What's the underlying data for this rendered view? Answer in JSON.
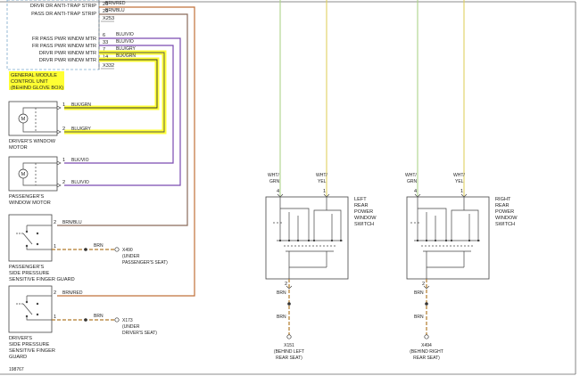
{
  "module": {
    "rows": [
      {
        "label": "DRVR DR ANTI-TRAP STRIP",
        "pin": "26"
      },
      {
        "label": "PASS DR ANTI-TRAP STRIP",
        "pin": "29"
      },
      {
        "label": "",
        "pin": ""
      },
      {
        "label": "FR PASS PWR WNDW MTR",
        "pin": "6"
      },
      {
        "label": "FR PASS PWR WNDW MTR",
        "pin": "33"
      },
      {
        "label": "DRVR PWR WNDW MTR",
        "pin": "7"
      },
      {
        "label": "DRVR PWR WNDW MTR",
        "pin": "14"
      }
    ],
    "connector1": "X253",
    "connector2": "X332",
    "name_lines": [
      "GENERAL MODULE",
      "CONTROL UNIT",
      "(BEHIND GLOVE BOX)"
    ]
  },
  "wires": {
    "w26": "BRN/RED",
    "w29": "BRN/BLU",
    "w6": "BLU/VIO",
    "w33": "BLU/VIO",
    "w7": "BLU/GRY",
    "w14": "BLK/GRN"
  },
  "driver_motor": {
    "name_lines": [
      "DRIVER'S WINDOW",
      "MOTOR"
    ],
    "pin1": "1",
    "wire1": "BLK/GRN",
    "pin2": "2",
    "wire2": "BLU/GRY",
    "symbol": "M"
  },
  "pass_motor": {
    "name_lines": [
      "PASSENGER'S",
      "WINDOW MOTOR"
    ],
    "pin1": "1",
    "wire1": "BLK/VIO",
    "pin2": "2",
    "wire2": "BLU/VIO",
    "symbol": "M"
  },
  "pass_guard": {
    "name_lines": [
      "PASSENGER'S",
      "SIDE PRESSURE",
      "SENSITIVE FINGER GUARD"
    ],
    "pin2": "2",
    "wire2": "BRN/BLU",
    "pin1": "1",
    "wire1": "BRN",
    "ground": "X490",
    "ground_loc": [
      "(UNDER",
      "PASSENGER'S SEAT)"
    ]
  },
  "drv_guard": {
    "name_lines": [
      "DRIVER'S",
      "SIDE PRESSURE",
      "SENSITIVE FINGER",
      "GUARD"
    ],
    "pin2": "2",
    "wire2": "BRN/RED",
    "pin1": "1",
    "wire1": "BRN",
    "ground": "X173",
    "ground_loc": [
      "(UNDER",
      "DRIVER'S SEAT)"
    ]
  },
  "left_switch": {
    "name_lines": [
      "LEFT",
      "REAR",
      "POWER",
      "WINDOW",
      "SWITCH"
    ],
    "in1_wire": [
      "WHT/",
      "GRN"
    ],
    "in1_pin": "4",
    "in2_wire": [
      "WHT/",
      "YEL"
    ],
    "in2_pin": "1",
    "out_pin": "2",
    "out_wire1": "BRN",
    "out_wire2": "BRN",
    "ground": "X151",
    "ground_loc": [
      "(BEHIND LEFT",
      "REAR SEAT)"
    ]
  },
  "right_switch": {
    "name_lines": [
      "RIGHT",
      "REAR",
      "POWER",
      "WINDOW",
      "SWITCH"
    ],
    "in1_wire": [
      "WHT/",
      "GRN"
    ],
    "in1_pin": "4",
    "in2_wire": [
      "WHT/",
      "YEL"
    ],
    "in2_pin": "1",
    "out_pin": "2",
    "out_wire1": "BRN",
    "out_wire2": "BRN",
    "ground": "X494",
    "ground_loc": [
      "(BEHIND RIGHT",
      "REAR SEAT)"
    ]
  },
  "figure_id": "198767",
  "colors": {
    "brn_red": "#c0703a",
    "brn_blu": "#8a6a5a",
    "blu_vio": "#7a4ab0",
    "highlight": "#ffff33",
    "wht_grn": "#aed38a",
    "wht_yel": "#e0d060",
    "brn": "#b07a2a",
    "dashed_box": "#7aa8cc",
    "component": "#333333"
  }
}
